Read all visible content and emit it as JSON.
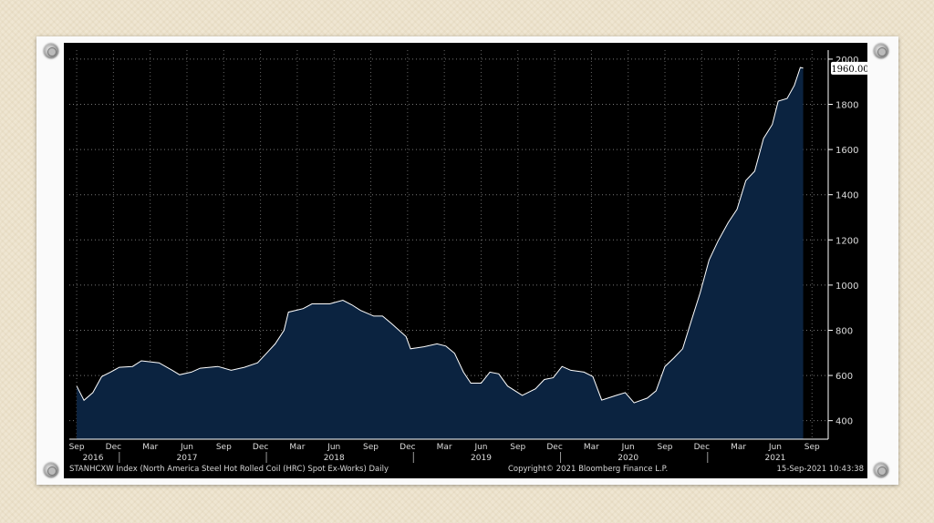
{
  "chart_data": {
    "type": "area",
    "title": "",
    "ticker_label": "STANHCXW Index (North America Steel Hot Rolled Coil (HRC) Spot Ex-Works)  Daily",
    "copyright": "Copyright© 2021 Bloomberg Finance L.P.",
    "timestamp": "15-Sep-2021 10:43:38",
    "last_value_label": "1960.00",
    "ylim": [
      318,
      2040
    ],
    "yticks": [
      400,
      600,
      800,
      1000,
      1200,
      1400,
      1600,
      1800,
      2000
    ],
    "ytick_labels": [
      "400",
      "600",
      "800",
      "1000",
      "1200",
      "1400",
      "1600",
      "1800",
      "2000"
    ],
    "xlim": [
      2016.62,
      2021.78
    ],
    "xticks": [
      {
        "x": 2016.67,
        "label": "Sep"
      },
      {
        "x": 2016.92,
        "label": "Dec"
      },
      {
        "x": 2017.17,
        "label": "Mar"
      },
      {
        "x": 2017.42,
        "label": "Jun"
      },
      {
        "x": 2017.67,
        "label": "Sep"
      },
      {
        "x": 2017.92,
        "label": "Dec"
      },
      {
        "x": 2018.17,
        "label": "Mar"
      },
      {
        "x": 2018.42,
        "label": "Jun"
      },
      {
        "x": 2018.67,
        "label": "Sep"
      },
      {
        "x": 2018.92,
        "label": "Dec"
      },
      {
        "x": 2019.17,
        "label": "Mar"
      },
      {
        "x": 2019.42,
        "label": "Jun"
      },
      {
        "x": 2019.67,
        "label": "Sep"
      },
      {
        "x": 2019.92,
        "label": "Dec"
      },
      {
        "x": 2020.17,
        "label": "Mar"
      },
      {
        "x": 2020.42,
        "label": "Jun"
      },
      {
        "x": 2020.67,
        "label": "Sep"
      },
      {
        "x": 2020.92,
        "label": "Dec"
      },
      {
        "x": 2021.17,
        "label": "Mar"
      },
      {
        "x": 2021.42,
        "label": "Jun"
      },
      {
        "x": 2021.67,
        "label": "Sep"
      }
    ],
    "year_labels": [
      {
        "x": 2016.67,
        "label": "2016"
      },
      {
        "x": 2017.42,
        "label": "2017"
      },
      {
        "x": 2018.42,
        "label": "2018"
      },
      {
        "x": 2019.42,
        "label": "2019"
      },
      {
        "x": 2020.42,
        "label": "2020"
      },
      {
        "x": 2021.42,
        "label": "2021"
      }
    ],
    "year_dividers": [
      2016.96,
      2017.96,
      2018.96,
      2019.96,
      2020.96
    ],
    "series": [
      {
        "name": "STANHCXW Index",
        "color": "#ffffff",
        "fill": "#0b2340",
        "x": [
          2016.67,
          2016.72,
          2016.78,
          2016.84,
          2016.9,
          2016.96,
          2017.05,
          2017.11,
          2017.23,
          2017.32,
          2017.37,
          2017.45,
          2017.51,
          2017.63,
          2017.72,
          2017.81,
          2017.9,
          2017.96,
          2018.02,
          2018.08,
          2018.11,
          2018.21,
          2018.27,
          2018.39,
          2018.48,
          2018.54,
          2018.6,
          2018.69,
          2018.75,
          2018.81,
          2018.91,
          2018.94,
          2019.03,
          2019.12,
          2019.18,
          2019.24,
          2019.3,
          2019.35,
          2019.42,
          2019.48,
          2019.54,
          2019.6,
          2019.7,
          2019.79,
          2019.85,
          2019.91,
          2019.97,
          2020.03,
          2020.12,
          2020.18,
          2020.24,
          2020.34,
          2020.4,
          2020.46,
          2020.55,
          2020.61,
          2020.67,
          2020.73,
          2020.79,
          2020.85,
          2020.91,
          2020.97,
          2021.03,
          2021.1,
          2021.16,
          2021.22,
          2021.28,
          2021.34,
          2021.4,
          2021.44,
          2021.5,
          2021.55,
          2021.59,
          2021.61
        ],
        "y": [
          553,
          490,
          524,
          595,
          615,
          636,
          640,
          665,
          656,
          623,
          603,
          615,
          632,
          640,
          623,
          636,
          656,
          698,
          740,
          800,
          880,
          896,
          917,
          917,
          933,
          913,
          888,
          863,
          863,
          830,
          772,
          718,
          727,
          740,
          730,
          698,
          615,
          566,
          566,
          615,
          607,
          553,
          512,
          541,
          582,
          590,
          640,
          623,
          615,
          595,
          491,
          512,
          524,
          479,
          500,
          532,
          640,
          677,
          718,
          843,
          967,
          1111,
          1194,
          1277,
          1335,
          1463,
          1504,
          1649,
          1711,
          1814,
          1826,
          1884,
          1963,
          1960
        ]
      }
    ]
  }
}
